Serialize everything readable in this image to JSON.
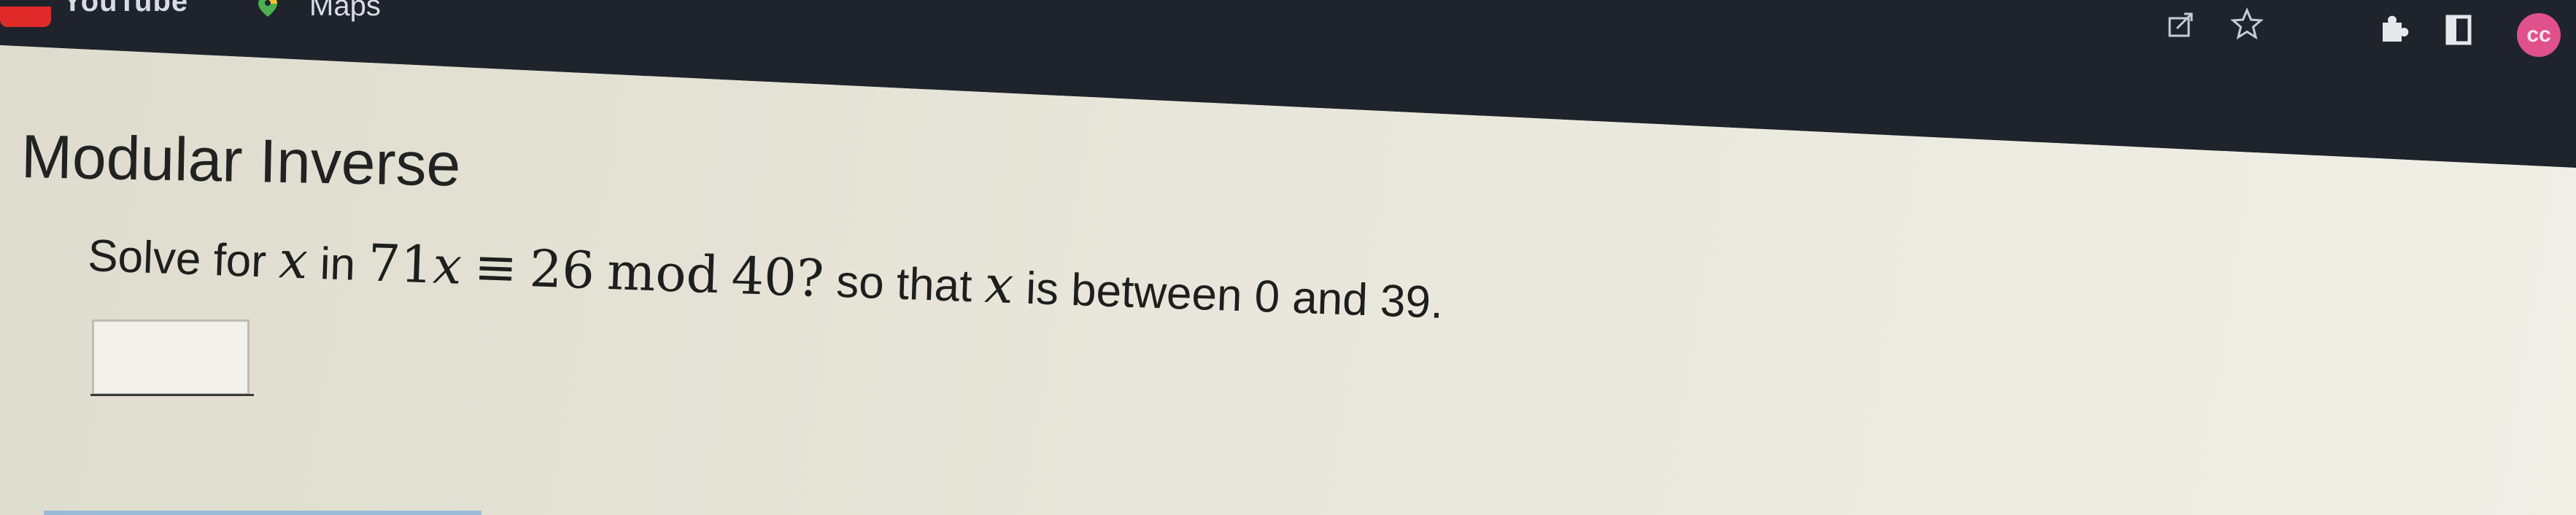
{
  "browser": {
    "bookmarks": [
      {
        "label": "YouTube",
        "icon": "youtube-icon"
      },
      {
        "label": "Maps",
        "icon": "maps-pin-icon"
      }
    ],
    "toolbar_icons": [
      "share-icon",
      "star-icon",
      "extensions-icon",
      "sidebar-icon",
      "profile-avatar"
    ],
    "avatar_text": "cc",
    "chrome_color": "#1f232b",
    "avatar_color": "#e0508a"
  },
  "question": {
    "title": "Modular Inverse",
    "prompt_prefix": "Solve for",
    "var_x": "x",
    "in_label": "in",
    "equation_coeff": "71",
    "equation_var": "x",
    "congruent_symbol": "≡",
    "equation_rhs": "26",
    "mod_label": "mod",
    "modulus": "40?",
    "prompt_middle": "so that",
    "var_x2": "x",
    "prompt_suffix": "is between 0 and 39.",
    "answer_value": ""
  }
}
